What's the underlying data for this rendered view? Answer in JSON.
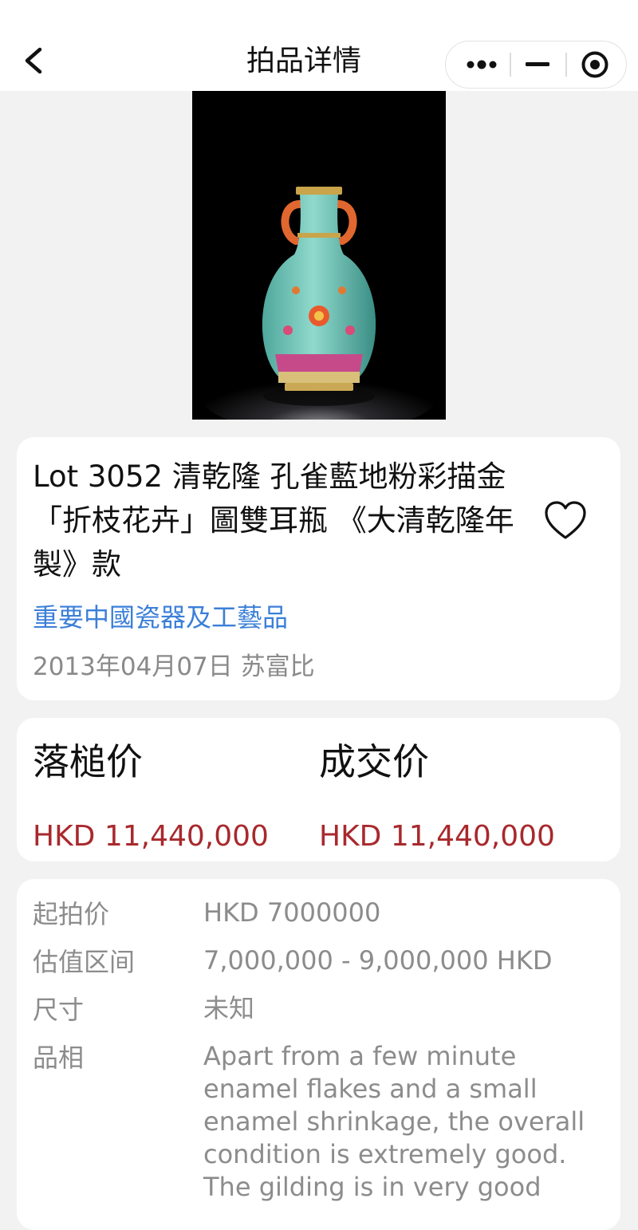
{
  "nav": {
    "title": "拍品详情"
  },
  "lot": {
    "title": "Lot 3052 清乾隆 孔雀藍地粉彩描金「折枝花卉」圖雙耳瓶 《大清乾隆年製》款",
    "session": "重要中國瓷器及工藝品",
    "meta": "2013年04月07日 苏富比"
  },
  "prices": {
    "hammer_label": "落槌价",
    "hammer_value": "HKD 11,440,000",
    "deal_label": "成交价",
    "deal_value": "HKD 11,440,000"
  },
  "details": {
    "start_label": "起拍价",
    "start_value": "HKD 7000000",
    "estimate_label": "估值区间",
    "estimate_value": "7,000,000 - 9,000,000 HKD",
    "size_label": "尺寸",
    "size_value": "未知",
    "condition_label": "品相",
    "condition_value": "Apart from a few minute enamel flakes and a small enamel shrinkage, the overall condition is extremely good. The gilding is in very good"
  },
  "icons": {
    "back": "chevron-left-icon",
    "more": "more-dots-icon",
    "minimize": "minus-icon",
    "close": "target-circle-icon",
    "favorite": "heart-outline-icon"
  },
  "colors": {
    "link": "#3b7fd8",
    "price": "#a8292d",
    "muted": "#8c8c8c",
    "background": "#f2f2f2"
  }
}
